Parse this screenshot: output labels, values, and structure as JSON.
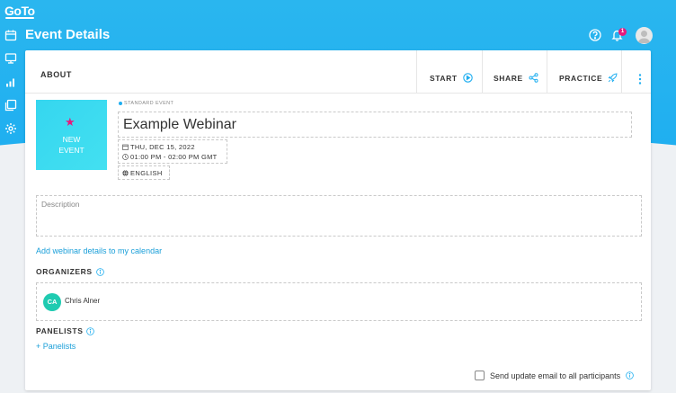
{
  "app": {
    "logo": "GoTo",
    "page_title": "Event Details",
    "notification_count": "1",
    "accent": "#1eaef0",
    "pink": "#e6197c"
  },
  "rail": {
    "items": [
      "calendar-icon",
      "monitor-icon",
      "analytics-icon",
      "recordings-icon",
      "settings-icon"
    ]
  },
  "tabs": {
    "about": "ABOUT",
    "start": "START",
    "share": "SHARE",
    "practice": "PRACTICE"
  },
  "event": {
    "thumb_line1": "NEW",
    "thumb_line2": "EVENT",
    "type": "STANDARD EVENT",
    "title": "Example Webinar",
    "date": "THU, DEC 15, 2022",
    "time": "01:00 PM - 02:00 PM GMT",
    "language": "ENGLISH",
    "description_placeholder": "Description",
    "calendar_link": "Add webinar details to my calendar"
  },
  "organizers": {
    "label": "ORGANIZERS",
    "items": [
      {
        "initials": "CA",
        "name": "Chris Alner"
      }
    ]
  },
  "panelists": {
    "label": "PANELISTS",
    "add_label": "+ Panelists"
  },
  "footer": {
    "send_update": "Send update email to all participants"
  }
}
